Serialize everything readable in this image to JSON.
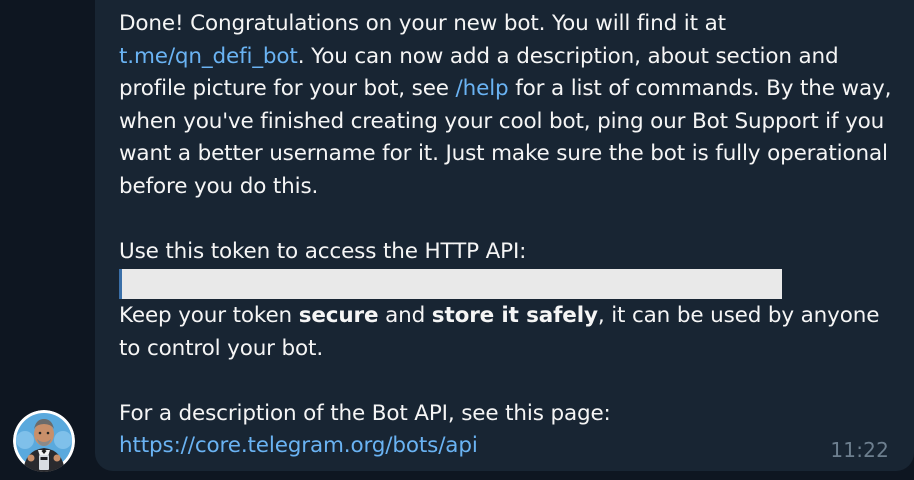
{
  "message": {
    "intro_1": "Done! Congratulations on your new bot. You will find it at ",
    "bot_link": "t.me/qn_defi_bot",
    "intro_2": ". You can now add a description, about section and profile picture for your bot, see ",
    "help_link": "/help",
    "intro_3": " for a list of commands. By the way, when you've finished creating your cool bot, ping our Bot Support if you want a better username for it. Just make sure the bot is fully operational before you do this.",
    "token_label": "Use this token to access the HTTP API:",
    "keep_1": "Keep your token ",
    "keep_bold_1": "secure",
    "keep_2": " and ",
    "keep_bold_2": "store it safely",
    "keep_3": ", it can be used by anyone to control your bot.",
    "api_desc": "For a description of the Bot API, see this page:",
    "api_link": "https://core.telegram.org/bots/api",
    "time": "11:22"
  },
  "avatar": {
    "icon": "botfather-avatar-icon",
    "background": "#5aa9dd"
  },
  "colors": {
    "background": "#0e1621",
    "bubble": "#182533",
    "text": "#f5f5f5",
    "link": "#6ab3f3",
    "time": "#6d7f8f"
  }
}
